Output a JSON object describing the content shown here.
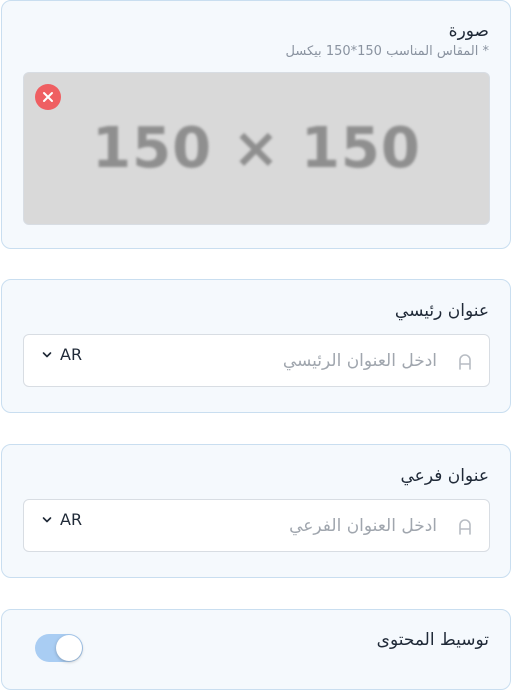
{
  "image_section": {
    "label": "صورة",
    "hint": "* المقاس المناسب 150*150 بيكسل",
    "placeholder_text": "150 × 150",
    "remove_icon": "close-icon"
  },
  "main_title": {
    "label": "عنوان رئيسي",
    "placeholder": "ادخل العنوان الرئيسي",
    "language": "AR",
    "icon": "user-icon"
  },
  "subtitle": {
    "label": "عنوان فرعي",
    "placeholder": "ادخل العنوان الفرعي",
    "language": "AR",
    "icon": "user-icon"
  },
  "center_content": {
    "label": "توسيط المحتوى",
    "enabled": true
  },
  "colors": {
    "card_bg": "#f5f9fd",
    "card_border": "#c9def0",
    "remove_red": "#ef5f62",
    "toggle_on": "#a9cdf3"
  }
}
